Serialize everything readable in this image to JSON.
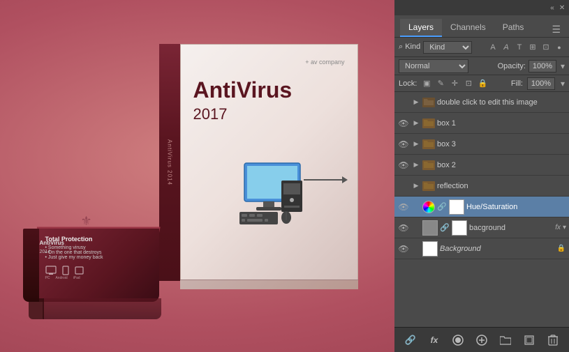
{
  "background": {
    "color": "#c07070"
  },
  "canvas": {
    "box_company": "+ av company",
    "box_title": "AntiVirus",
    "box_year": "2017",
    "box_spine_text": "AntiVirus 2014",
    "small_box_title": "Total Protection",
    "small_box_bullets": [
      "• Something virusy",
      "• On the one that destroys",
      "• Just give my money back"
    ],
    "small_label_1": "AntiVirus",
    "small_label_2": "2014"
  },
  "panels": {
    "titlebar": {
      "collapse_label": "«",
      "close_label": "✕"
    },
    "tabs": [
      {
        "label": "Layers",
        "active": true
      },
      {
        "label": "Channels",
        "active": false
      },
      {
        "label": "Paths",
        "active": false
      }
    ],
    "menu_icon": "☰",
    "kind_row": {
      "label": "⌕ Kind",
      "dropdown": "Kind",
      "icons": [
        "A",
        "T",
        "⊞",
        "⊡",
        "●"
      ]
    },
    "blend_row": {
      "blend_label": "Normal",
      "opacity_label": "Opacity:",
      "opacity_value": "100%"
    },
    "lock_row": {
      "lock_label": "Lock:",
      "lock_icons": [
        "▣",
        "∥",
        "✛",
        "⊡",
        "🔒"
      ],
      "fill_label": "Fill:",
      "fill_value": "100%"
    },
    "layers": [
      {
        "id": "layer-double-click",
        "eye_visible": false,
        "has_arrow": true,
        "folder": true,
        "folder_color": "dark",
        "name": "double click to edit this image",
        "italic": false,
        "has_link": false,
        "has_thumb": false,
        "has_fx": false,
        "has_lock": false,
        "selected": false
      },
      {
        "id": "layer-box1",
        "eye_visible": true,
        "has_arrow": true,
        "folder": true,
        "folder_color": "normal",
        "name": "box 1",
        "italic": false,
        "has_link": false,
        "has_thumb": false,
        "has_fx": false,
        "has_lock": false,
        "selected": false
      },
      {
        "id": "layer-box3",
        "eye_visible": true,
        "has_arrow": true,
        "folder": true,
        "folder_color": "normal",
        "name": "box 3",
        "italic": false,
        "has_link": false,
        "has_thumb": false,
        "has_fx": false,
        "has_lock": false,
        "selected": false
      },
      {
        "id": "layer-box2",
        "eye_visible": true,
        "has_arrow": true,
        "folder": true,
        "folder_color": "normal",
        "name": "box 2",
        "italic": false,
        "has_link": false,
        "has_thumb": false,
        "has_fx": false,
        "has_lock": false,
        "selected": false
      },
      {
        "id": "layer-reflection",
        "eye_visible": false,
        "has_arrow": true,
        "folder": true,
        "folder_color": "normal",
        "name": "reflection",
        "italic": false,
        "has_link": false,
        "has_thumb": false,
        "has_fx": false,
        "has_lock": false,
        "selected": false
      },
      {
        "id": "layer-huesat",
        "eye_visible": true,
        "has_arrow": false,
        "folder": false,
        "type": "huesat",
        "name": "Hue/Saturation",
        "italic": false,
        "has_link": true,
        "thumb_type": "white",
        "has_fx": false,
        "has_lock": false,
        "selected": true
      },
      {
        "id": "layer-background-copy",
        "eye_visible": true,
        "has_arrow": false,
        "folder": false,
        "type": "normal",
        "name": "bacground",
        "italic": false,
        "has_link": true,
        "thumb_type": "gray",
        "has_fx": true,
        "has_lock": false,
        "selected": false
      },
      {
        "id": "layer-background",
        "eye_visible": true,
        "has_arrow": false,
        "folder": false,
        "type": "normal",
        "name": "Background",
        "italic": true,
        "has_link": false,
        "thumb_type": "white",
        "has_fx": false,
        "has_lock": true,
        "selected": false
      }
    ],
    "bottom_buttons": [
      "🔗",
      "fx",
      "⬤",
      "◎",
      "▣",
      "⧉",
      "🗑"
    ]
  }
}
